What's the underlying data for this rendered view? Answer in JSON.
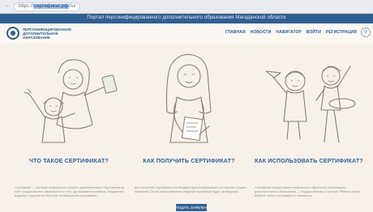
{
  "browser": {
    "back_glyph": "← →",
    "url_prefix": "https://",
    "url_highlight": "сертификат.рф",
    "url_suffix": "/ru/"
  },
  "banner": {
    "text": "Портал персонифицированного дополнительного образования Магаданской области"
  },
  "header": {
    "logo_text": "ПЕРСОНИФИЦИРОВАННОЕ ДОПОЛНИТЕЛЬНОЕ ОБРАЗОВАНИЕ",
    "menu": [
      {
        "label": "ГЛАВНАЯ"
      },
      {
        "label": "НОВОСТИ"
      },
      {
        "label": "НАВИГАТОР"
      },
      {
        "label": "ВОЙТИ"
      },
      {
        "label": "РЕГИСТРАЦИЯ"
      }
    ],
    "search_glyph": "⚲"
  },
  "sections": [
    {
      "title": "ЧТО ТАКОЕ СЕРТИФИКАТ?",
      "text": "Сертификат — это ваша возможность оплатить дополнительное образование за счёт государства вне зависимости от того, где занимается ребёнок. Государство выделяет средства на обучение по выбранным программам."
    },
    {
      "title": "КАК ПОЛУЧИТЬ СЕРТИФИКАТ?",
      "text": "Для получения сертификата необходимо зарегистрироваться на портале и подать заявление. После предоставления сведений сертификат будет активирован."
    },
    {
      "title": "КАК ИСПОЛЬЗОВАТЬ СЕРТИФИКАТ?",
      "text": "Сертификат предоставляет возможность обучаться в организациях дополнительного образования — государственных и частных. Ребёнок может выбрать любые программы из навигатора."
    }
  ],
  "cta": {
    "label": "ПОДАТЬ ЗАЯВЛЕНИЕ"
  },
  "colors": {
    "brand": "#2f5f91",
    "background": "#f6f1ea",
    "sketch": "#8b7f74"
  }
}
